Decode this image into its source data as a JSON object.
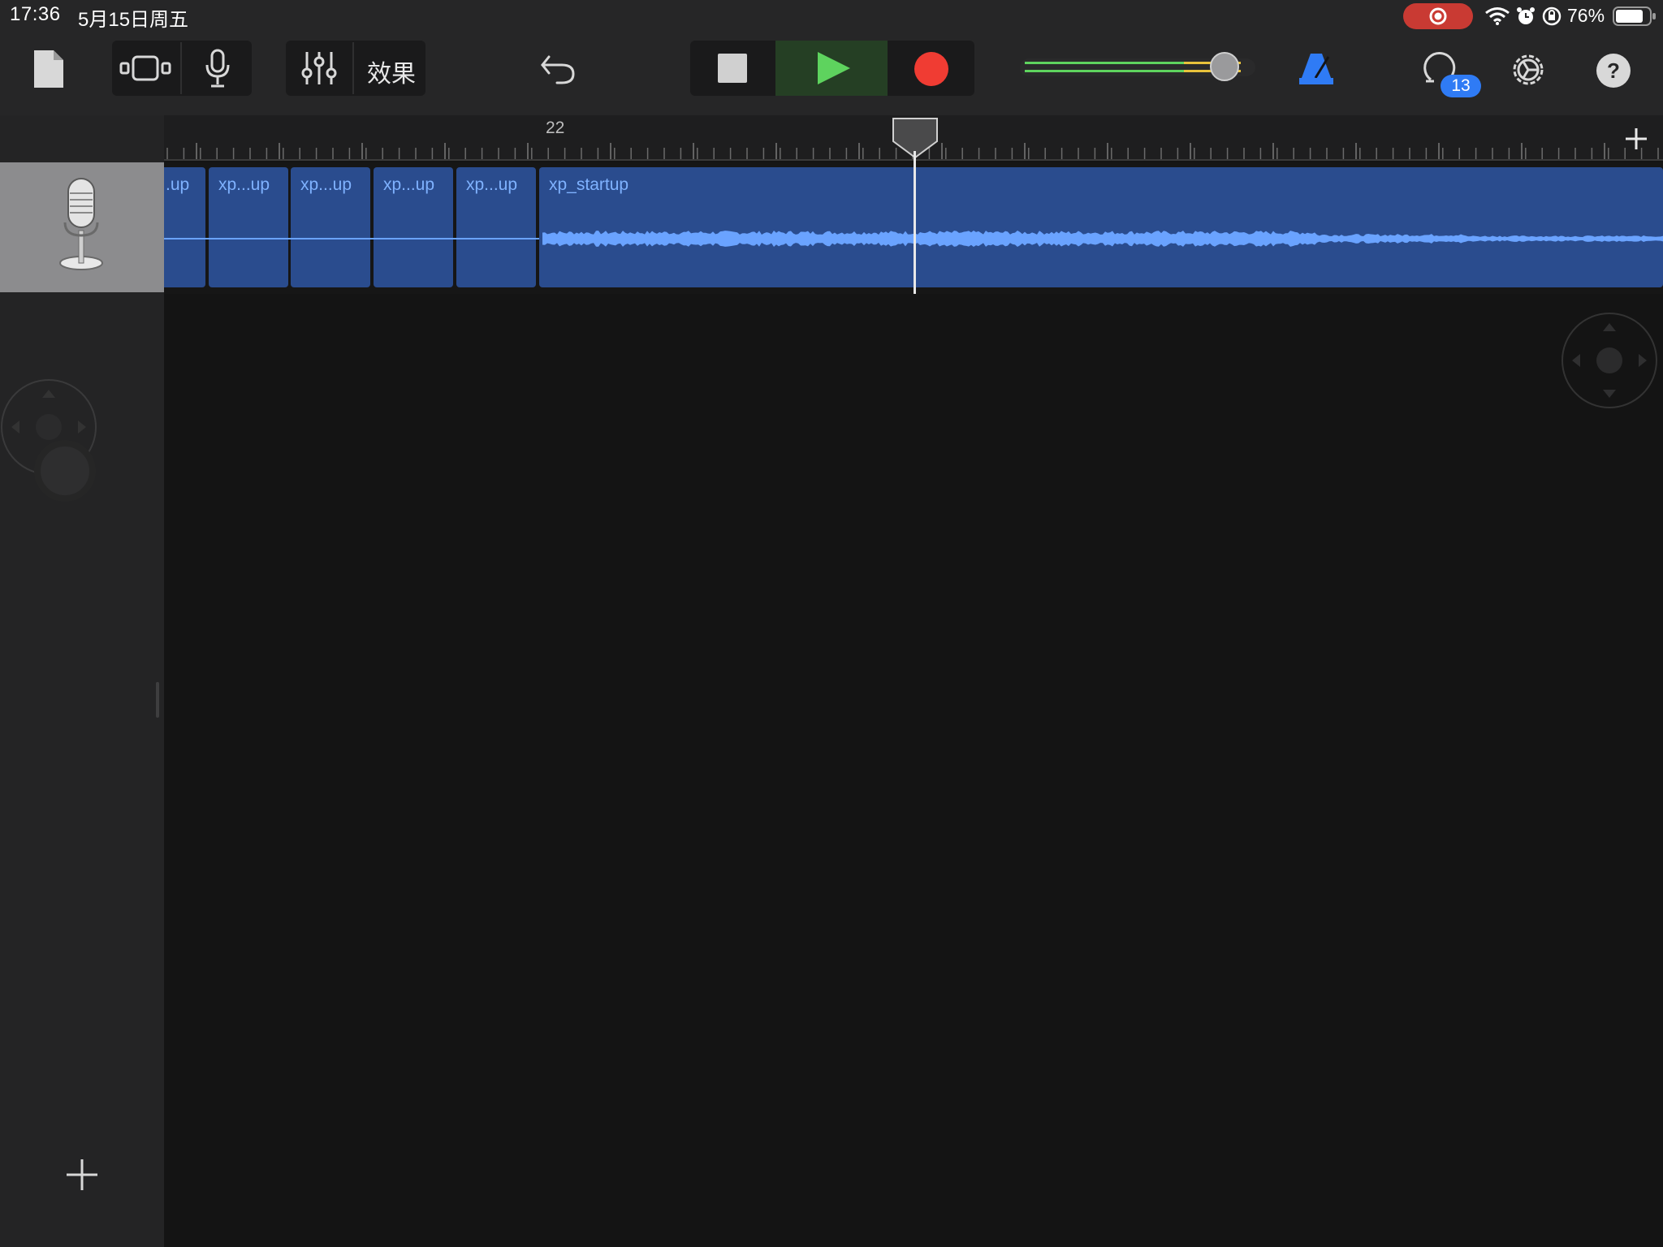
{
  "status_bar": {
    "time": "17:36",
    "date": "5月15日周五",
    "battery": "76%"
  },
  "toolbar": {
    "effects_label": "效果",
    "loop_badge_count": "13"
  },
  "ruler": {
    "bar_label": "22"
  },
  "regions": [
    {
      "label": ".up"
    },
    {
      "label": "xp...up"
    },
    {
      "label": "xp...up"
    },
    {
      "label": "xp...up"
    },
    {
      "label": "xp...up"
    },
    {
      "label": "xp_startup"
    }
  ],
  "colors": {
    "region_fill": "#2a4c8e",
    "region_text": "#7fb2ff",
    "play_green": "#5ed35e",
    "record_red": "#f03c33",
    "metronome_blue": "#2f7bf5"
  },
  "master_volume_level": 0.88
}
